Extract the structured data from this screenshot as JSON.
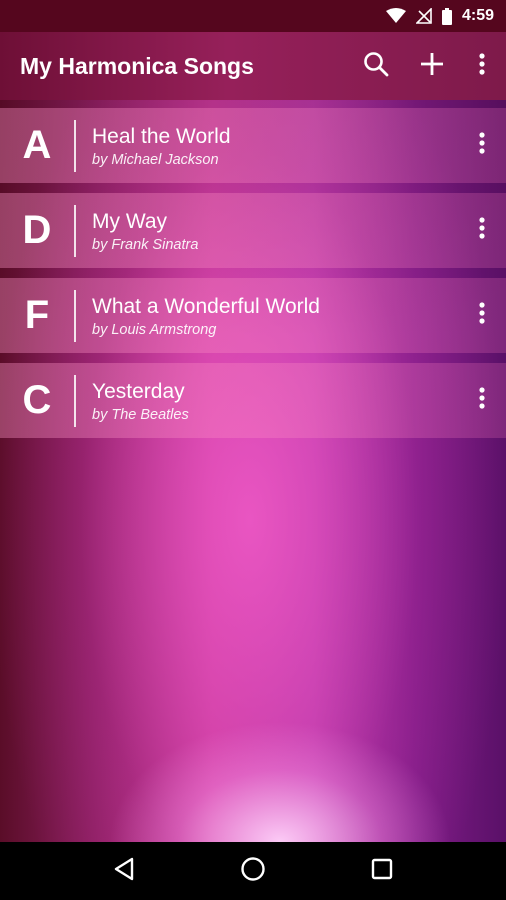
{
  "status_bar": {
    "time": "4:59",
    "icons": [
      "wifi-icon",
      "no-signal-icon",
      "battery-icon"
    ]
  },
  "app_bar": {
    "title": "My Harmonica Songs",
    "actions": [
      "search-icon",
      "add-icon",
      "more-vert-icon"
    ]
  },
  "songs": [
    {
      "key": "A",
      "title": "Heal the World",
      "artist": "by Michael Jackson"
    },
    {
      "key": "D",
      "title": "My Way",
      "artist": "by Frank Sinatra"
    },
    {
      "key": "F",
      "title": "What a Wonderful World",
      "artist": "by Louis Armstrong"
    },
    {
      "key": "C",
      "title": "Yesterday",
      "artist": "by The Beatles"
    }
  ],
  "nav_bar": {
    "buttons": [
      "back-icon",
      "home-icon",
      "recents-icon"
    ]
  },
  "colors": {
    "status_bar": "#55061e",
    "app_bar": "#96205a",
    "accent": "#c93c9a",
    "text": "#ffffff"
  }
}
